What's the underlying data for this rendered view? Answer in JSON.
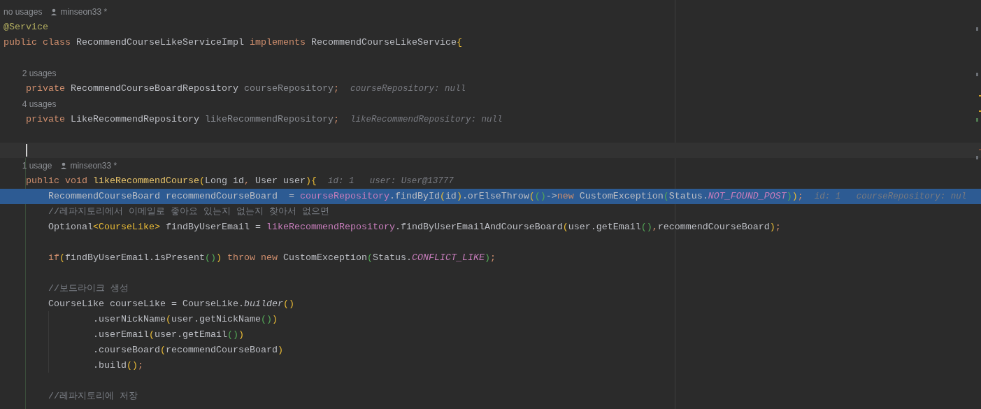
{
  "editor": {
    "lines": [
      {
        "kind": "hint",
        "text": "no usages",
        "author": "minseon33 *"
      },
      {
        "kind": "code",
        "tokens": [
          {
            "text": "@Service",
            "kind": "annotation"
          }
        ]
      },
      {
        "kind": "code",
        "tokens": [
          {
            "text": "public class ",
            "kind": "keyword"
          },
          {
            "text": "RecommendCourseLikeServiceImpl ",
            "kind": "plain"
          },
          {
            "text": "implements ",
            "kind": "keyword"
          },
          {
            "text": "RecommendCourseLikeService",
            "kind": "plain"
          },
          {
            "text": "{",
            "kind": "brace"
          }
        ],
        "children": [
          {
            "kind": "blank"
          },
          {
            "kind": "hint",
            "text": "2 usages"
          },
          {
            "kind": "code",
            "tokens": [
              {
                "text": "private ",
                "kind": "keyword"
              },
              {
                "text": "RecommendCourseBoardRepository ",
                "kind": "plain"
              },
              {
                "text": "courseRepository",
                "kind": "unused"
              },
              {
                "text": ";",
                "kind": "keyword"
              }
            ],
            "inlays": [
              "courseRepository: null"
            ]
          },
          {
            "kind": "hint",
            "text": "4 usages"
          },
          {
            "kind": "code",
            "tokens": [
              {
                "text": "private ",
                "kind": "keyword"
              },
              {
                "text": "LikeRecommendRepository ",
                "kind": "plain"
              },
              {
                "text": "likeRecommendRepository",
                "kind": "unused"
              },
              {
                "text": ";",
                "kind": "keyword"
              }
            ],
            "inlays": [
              "likeRecommendRepository: null"
            ]
          },
          {
            "kind": "blank"
          },
          {
            "kind": "caret"
          },
          {
            "kind": "hint",
            "text": "1 usage",
            "author": "minseon33 *"
          },
          {
            "kind": "code",
            "tokens": [
              {
                "text": "public void ",
                "kind": "keyword"
              },
              {
                "text": "likeRecommendCourse",
                "kind": "method"
              },
              {
                "text": "(",
                "kind": "paren"
              },
              {
                "text": "Long id",
                "kind": "plain"
              },
              {
                "text": ", ",
                "kind": "keyword"
              },
              {
                "text": "User user",
                "kind": "plain"
              },
              {
                "text": ")",
                "kind": "paren"
              },
              {
                "text": "{",
                "kind": "brace"
              }
            ],
            "inlays": [
              "id: 1",
              "user: User@13777"
            ],
            "children": [
              {
                "kind": "execution",
                "tokens": [
                  {
                    "text": "RecommendCourseBoard recommendCourseBoard  = ",
                    "kind": "plain"
                  },
                  {
                    "text": "courseRepository",
                    "kind": "field"
                  },
                  {
                    "text": ".findById",
                    "kind": "plain"
                  },
                  {
                    "text": "(",
                    "kind": "paren"
                  },
                  {
                    "text": "id",
                    "kind": "plain"
                  },
                  {
                    "text": ")",
                    "kind": "paren"
                  },
                  {
                    "text": ".orElseThrow",
                    "kind": "plain"
                  },
                  {
                    "text": "(",
                    "kind": "paren"
                  },
                  {
                    "text": "()",
                    "kind": "paren2"
                  },
                  {
                    "text": "->",
                    "kind": "plain"
                  },
                  {
                    "text": "new ",
                    "kind": "keyword"
                  },
                  {
                    "text": "CustomException",
                    "kind": "plain"
                  },
                  {
                    "text": "(",
                    "kind": "paren2"
                  },
                  {
                    "text": "Status.",
                    "kind": "plain"
                  },
                  {
                    "text": "NOT_FOUND_POST",
                    "kind": "constant"
                  },
                  {
                    "text": ")",
                    "kind": "paren2"
                  },
                  {
                    "text": ")",
                    "kind": "paren"
                  },
                  {
                    "text": ";",
                    "kind": "keyword"
                  }
                ],
                "inlays": [
                  "id: 1",
                  "courseRepository: nul"
                ]
              },
              {
                "kind": "code",
                "tokens": [
                  {
                    "text": "//레파지토리에서 이메일로 좋아요 있는지 없는지 찾아서 없으면",
                    "kind": "comment"
                  }
                ]
              },
              {
                "kind": "code",
                "tokens": [
                  {
                    "text": "Optional",
                    "kind": "plain"
                  },
                  {
                    "text": "<CourseLike>",
                    "kind": "paren"
                  },
                  {
                    "text": " findByUserEmail = ",
                    "kind": "plain"
                  },
                  {
                    "text": "likeRecommendRepository",
                    "kind": "field"
                  },
                  {
                    "text": ".findByUserEmailAndCourseBoard",
                    "kind": "plain"
                  },
                  {
                    "text": "(",
                    "kind": "paren"
                  },
                  {
                    "text": "user.getEmail",
                    "kind": "plain"
                  },
                  {
                    "text": "()",
                    "kind": "paren2"
                  },
                  {
                    "text": ",",
                    "kind": "keyword"
                  },
                  {
                    "text": "recommendCourseBoard",
                    "kind": "plain"
                  },
                  {
                    "text": ")",
                    "kind": "paren"
                  },
                  {
                    "text": ";",
                    "kind": "keyword"
                  }
                ]
              },
              {
                "kind": "blank"
              },
              {
                "kind": "code",
                "tokens": [
                  {
                    "text": "if",
                    "kind": "keyword"
                  },
                  {
                    "text": "(",
                    "kind": "paren"
                  },
                  {
                    "text": "findByUserEmail.isPresent",
                    "kind": "plain"
                  },
                  {
                    "text": "()",
                    "kind": "paren2"
                  },
                  {
                    "text": ")",
                    "kind": "paren"
                  },
                  {
                    "text": " throw new ",
                    "kind": "keyword"
                  },
                  {
                    "text": "CustomException",
                    "kind": "plain"
                  },
                  {
                    "text": "(",
                    "kind": "paren2"
                  },
                  {
                    "text": "Status.",
                    "kind": "plain"
                  },
                  {
                    "text": "CONFLICT_LIKE",
                    "kind": "constant"
                  },
                  {
                    "text": ")",
                    "kind": "paren2"
                  },
                  {
                    "text": ";",
                    "kind": "keyword"
                  }
                ]
              },
              {
                "kind": "blank"
              },
              {
                "kind": "code",
                "tokens": [
                  {
                    "text": "//보드라이크 생성",
                    "kind": "comment"
                  }
                ]
              },
              {
                "kind": "code",
                "continuation": true,
                "tokens": [
                  {
                    "text": "CourseLike courseLike = CourseLike.",
                    "kind": "plain"
                  },
                  {
                    "text": "builder",
                    "kind": "static"
                  },
                  {
                    "text": "()",
                    "kind": "paren"
                  }
                ],
                "children": [
                  {
                    "kind": "code",
                    "tokens": [
                      {
                        "text": ".userNickName",
                        "kind": "plain"
                      },
                      {
                        "text": "(",
                        "kind": "paren"
                      },
                      {
                        "text": "user.getNickName",
                        "kind": "plain"
                      },
                      {
                        "text": "()",
                        "kind": "paren2"
                      },
                      {
                        "text": ")",
                        "kind": "paren"
                      }
                    ]
                  },
                  {
                    "kind": "code",
                    "tokens": [
                      {
                        "text": ".userEmail",
                        "kind": "plain"
                      },
                      {
                        "text": "(",
                        "kind": "paren"
                      },
                      {
                        "text": "user.getEmail",
                        "kind": "plain"
                      },
                      {
                        "text": "()",
                        "kind": "paren2"
                      },
                      {
                        "text": ")",
                        "kind": "paren"
                      }
                    ]
                  },
                  {
                    "kind": "code",
                    "tokens": [
                      {
                        "text": ".courseBoard",
                        "kind": "plain"
                      },
                      {
                        "text": "(",
                        "kind": "paren"
                      },
                      {
                        "text": "recommendCourseBoard",
                        "kind": "plain"
                      },
                      {
                        "text": ")",
                        "kind": "paren"
                      }
                    ]
                  },
                  {
                    "kind": "code",
                    "tokens": [
                      {
                        "text": ".build",
                        "kind": "plain"
                      },
                      {
                        "text": "()",
                        "kind": "paren"
                      },
                      {
                        "text": ";",
                        "kind": "keyword"
                      }
                    ]
                  }
                ]
              },
              {
                "kind": "blank"
              },
              {
                "kind": "code",
                "tokens": [
                  {
                    "text": "//레파지토리에 저장",
                    "kind": "comment"
                  }
                ]
              }
            ]
          }
        ]
      }
    ]
  }
}
